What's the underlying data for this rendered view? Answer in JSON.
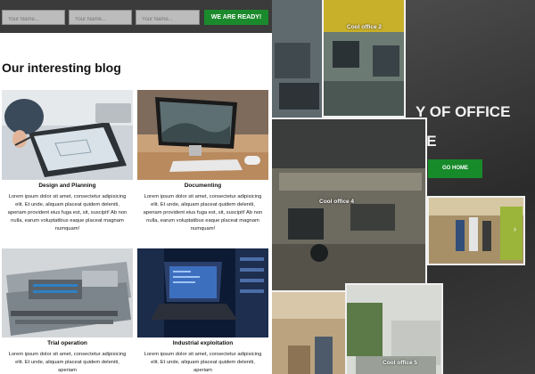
{
  "form": {
    "fields": [
      {
        "placeholder": "Your Name..."
      },
      {
        "placeholder": "Your Name..."
      },
      {
        "placeholder": "Your Name..."
      }
    ],
    "submit_label": "WE ARE READY!"
  },
  "blog": {
    "heading": "Our interesting blog",
    "cards": [
      {
        "title": "Design and Planning",
        "text": "Lorem ipsum dolor sit amet, consectetur adipisicing elit. Et unde, aliquam placeat quidem deleniti, aperiam provident eius fuga est, sit, suscipit! Ab non nulla, earum voluptatibus eaque placeat magnam numquam!"
      },
      {
        "title": "Documenting",
        "text": "Lorem ipsum dolor sit amet, consectetur adipisicing elit. Et unde, aliquam placeat quidem deleniti, aperiam provident eius fuga est, sit, suscipit! Ab non nulla, earum voluptatibus eaque placeat magnam numquam!"
      },
      {
        "title": "Trial operation",
        "text": "Lorem ipsum dolor sit amet, consectetur adipisicing elit. Et unde, aliquam placeat quidem deleniti, aperiam"
      },
      {
        "title": "Industrial exploitation",
        "text": "Lorem ipsum dolor sit amet, consectetur adipisicing elit. Et unde, aliquam placeat quidem deleniti, aperiam"
      }
    ]
  },
  "hero": {
    "title": "Y OF OFFICE",
    "subtitle": "CE",
    "button_label": "GO HOME"
  },
  "gallery": {
    "captions": [
      "Cool office 2",
      "Cool office 4",
      "Cool office 5"
    ],
    "arrow": "›"
  },
  "colors": {
    "accent_green": "#1b8a2c",
    "topbar": "#3b3b3b"
  },
  "icons": [
    "chevron-right-icon"
  ]
}
